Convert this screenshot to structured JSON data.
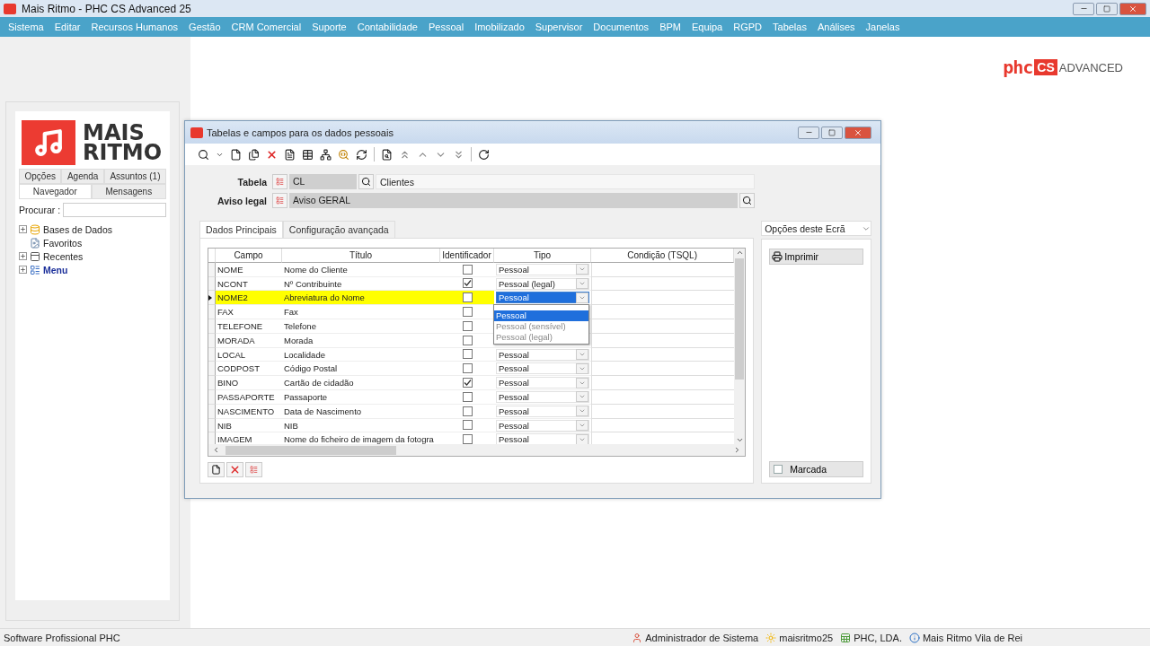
{
  "app_title": "Mais Ritmo - PHC CS Advanced 25",
  "menu": [
    "Sistema",
    "Editar",
    "Recursos Humanos",
    "Gestão",
    "CRM Comercial",
    "Suporte",
    "Contabilidade",
    "Pessoal",
    "Imobilizado",
    "Supervisor",
    "Documentos",
    "BPM",
    "Equipa",
    "RGPD",
    "Tabelas",
    "Análises",
    "Janelas"
  ],
  "brand": {
    "prefix": "phc",
    "mark": "CS",
    "suffix": "ADVANCED"
  },
  "sidebar": {
    "logo_lines": [
      "MAIS",
      "RITMO"
    ],
    "tabs_top": [
      {
        "label": "Opções",
        "selected": false
      },
      {
        "label": "Agenda",
        "selected": false
      },
      {
        "label": "Assuntos (1)",
        "selected": false
      }
    ],
    "tabs": [
      {
        "label": "Navegador",
        "selected": true
      },
      {
        "label": "Mensagens",
        "selected": false
      }
    ],
    "search_label": "Procurar :",
    "tree": [
      {
        "label": "Bases de Dados",
        "expandable": true,
        "highlighted": false
      },
      {
        "label": "Favoritos",
        "expandable": false,
        "highlighted": false
      },
      {
        "label": "Recentes",
        "expandable": true,
        "highlighted": false
      },
      {
        "label": "Menu",
        "expandable": true,
        "highlighted": true
      }
    ]
  },
  "dialog": {
    "title": "Tabelas e campos para os dados pessoais",
    "tabela": {
      "label": "Tabela",
      "code": "CL",
      "description": "Clientes"
    },
    "aviso": {
      "label": "Aviso legal",
      "value": "Aviso GERAL"
    },
    "tabs": [
      {
        "label": "Dados Principais",
        "selected": true
      },
      {
        "label": "Configuração avançada",
        "selected": false
      }
    ],
    "columns": [
      "Campo",
      "Título",
      "Identificador",
      "Tipo",
      "Condição (TSQL)"
    ],
    "rows": [
      {
        "campo": "NOME",
        "titulo": "Nome do Cliente",
        "identificador": false,
        "tipo": "Pessoal",
        "selected": false
      },
      {
        "campo": "NCONT",
        "titulo": "Nº Contribuinte",
        "identificador": true,
        "tipo": "Pessoal (legal)",
        "selected": false
      },
      {
        "campo": "NOME2",
        "titulo": "Abreviatura do Nome",
        "identificador": false,
        "tipo": "Pessoal",
        "selected": true
      },
      {
        "campo": "FAX",
        "titulo": "Fax",
        "identificador": false,
        "selected": false
      },
      {
        "campo": "TELEFONE",
        "titulo": "Telefone",
        "identificador": false,
        "selected": false
      },
      {
        "campo": "MORADA",
        "titulo": "Morada",
        "identificador": false,
        "selected": false
      },
      {
        "campo": "LOCAL",
        "titulo": "Localidade",
        "identificador": false,
        "tipo": "Pessoal",
        "selected": false
      },
      {
        "campo": "CODPOST",
        "titulo": "Código Postal",
        "identificador": false,
        "tipo": "Pessoal",
        "selected": false
      },
      {
        "campo": "BINO",
        "titulo": "Cartão de cidadão",
        "identificador": true,
        "tipo": "Pessoal",
        "selected": false
      },
      {
        "campo": "PASSAPORTE",
        "titulo": "Passaporte",
        "identificador": false,
        "tipo": "Pessoal",
        "selected": false
      },
      {
        "campo": "NASCIMENTO",
        "titulo": "Data de Nascimento",
        "identificador": false,
        "tipo": "Pessoal",
        "selected": false
      },
      {
        "campo": "NIB",
        "titulo": "NIB",
        "identificador": false,
        "tipo": "Pessoal",
        "selected": false
      },
      {
        "campo": "IMAGEM",
        "titulo": "Nome do ficheiro de imagem da fotogra",
        "identificador": false,
        "tipo": "Pessoal",
        "selected": false
      }
    ],
    "dropdown": [
      {
        "label": "Pessoal",
        "selected": true
      },
      {
        "label": "Pessoal (sensível)",
        "selected": false
      },
      {
        "label": "Pessoal (legal)",
        "selected": false
      }
    ],
    "options_select": "Opções deste Ecrã",
    "print_button": "Imprimir",
    "marcada": {
      "label": "Marcada",
      "checked": false
    }
  },
  "status_bar": {
    "left": "Software Profissional PHC",
    "items": [
      "Administrador de Sistema",
      "maisritmo25",
      "PHC, LDA.",
      "Mais Ritmo Vila de Rei"
    ]
  }
}
